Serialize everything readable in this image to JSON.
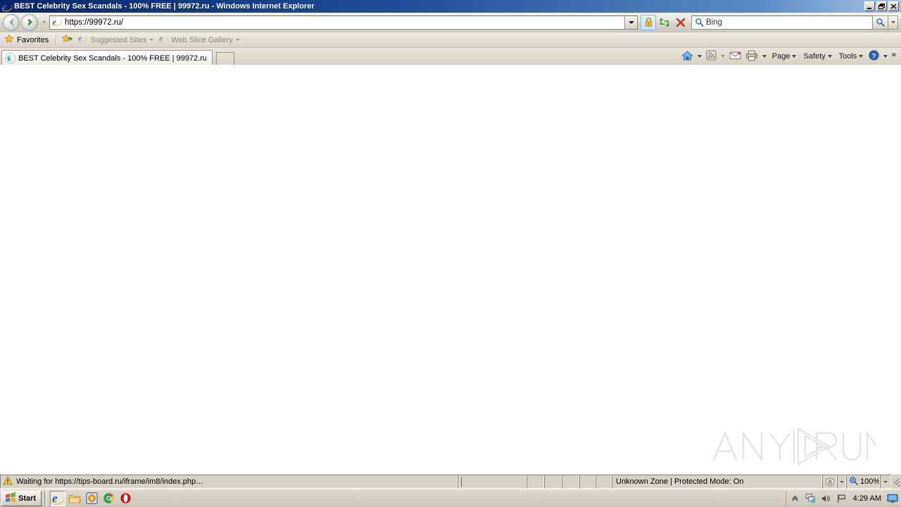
{
  "window": {
    "title": "BEST Celebrity Sex Scandals - 100% FREE | 99972.ru - Windows Internet Explorer",
    "app_icon": "internet-explorer-icon",
    "controls": {
      "minimize": "minimize-button",
      "restore": "restore-button",
      "close": "close-button"
    }
  },
  "navbar": {
    "back_label": "Back",
    "forward_label": "Forward",
    "recent_pages_label": "Recent Pages",
    "address": {
      "value": "https://99972.ru/",
      "placeholder": "",
      "favicon": "internet-explorer-icon",
      "dropdown_label": "Address history"
    },
    "buttons": {
      "security_lock": "Security Report",
      "refresh": "Refresh",
      "stop": "Stop"
    },
    "search": {
      "placeholder": "Bing",
      "value": "",
      "go_label": "Search",
      "provider_dropdown_label": "Search provider"
    }
  },
  "favorites_bar": {
    "items": [
      {
        "label": "Favorites",
        "icon": "star-icon",
        "dim": false,
        "caret": false
      },
      {
        "label": "Suggested Sites",
        "icon": "internet-explorer-icon",
        "dim": true,
        "caret": true
      },
      {
        "label": "Web Slice Gallery",
        "icon": "internet-explorer-icon",
        "dim": true,
        "caret": true
      }
    ],
    "add_favorites_icon": "add-to-favorites-icon"
  },
  "tabs": {
    "items": [
      {
        "label": "BEST Celebrity Sex Scandals - 100% FREE | 99972.ru",
        "icon": "loading-spinner-icon",
        "active": true
      }
    ],
    "new_tab_label": "New Tab"
  },
  "command_bar": {
    "items": [
      {
        "label": "",
        "icon": "home-icon",
        "caret": true,
        "dim": false
      },
      {
        "label": "",
        "icon": "feeds-icon",
        "caret": true,
        "dim": true
      },
      {
        "label": "",
        "icon": "read-mail-icon",
        "caret": false,
        "dim": true
      },
      {
        "label": "",
        "icon": "print-icon",
        "caret": true,
        "dim": false
      },
      {
        "label": "Page",
        "icon": "",
        "caret": true,
        "dim": false
      },
      {
        "label": "Safety",
        "icon": "",
        "caret": true,
        "dim": false
      },
      {
        "label": "Tools",
        "icon": "",
        "caret": true,
        "dim": false
      },
      {
        "label": "",
        "icon": "help-icon",
        "caret": true,
        "dim": false
      }
    ],
    "overflow_label": "»"
  },
  "page": {
    "content": "",
    "watermark": {
      "text_left": "ANY",
      "text_right": "RUN",
      "logo": "play-triangle-icon"
    }
  },
  "status_bar": {
    "icon": "warning-icon",
    "message": "Waiting for https://tips-board.ru/iframe/im8/index.php…",
    "zone": "Unknown Zone | Protected Mode: On",
    "zone_icon": "protected-zone-icon",
    "zoom_level": "100%",
    "zoom_icon": "zoom-icon"
  },
  "taskbar": {
    "start_label": "Start",
    "start_icon": "windows-flag-icon",
    "quick_launch": [
      {
        "name": "internet-explorer",
        "active": true
      },
      {
        "name": "windows-explorer",
        "active": false
      },
      {
        "name": "media-player",
        "active": false
      },
      {
        "name": "google-chrome",
        "active": false
      },
      {
        "name": "opera-browser",
        "active": false
      }
    ],
    "tray": {
      "show_hidden_icons": "chevron-up-icon",
      "icons": [
        "network-icon",
        "volume-icon",
        "flag-icon"
      ],
      "time": "4:29 AM",
      "desktop_icon": "show-desktop-icon"
    }
  },
  "colors": {
    "titlebar_start": "#0a246a",
    "titlebar_end": "#a8c4e4",
    "chrome_face": "#d6d2c8",
    "page_bg": "#ffffff",
    "accent_green": "#2e9e2e",
    "accent_red": "#c62828",
    "lock_gold": "#e8b52c"
  }
}
